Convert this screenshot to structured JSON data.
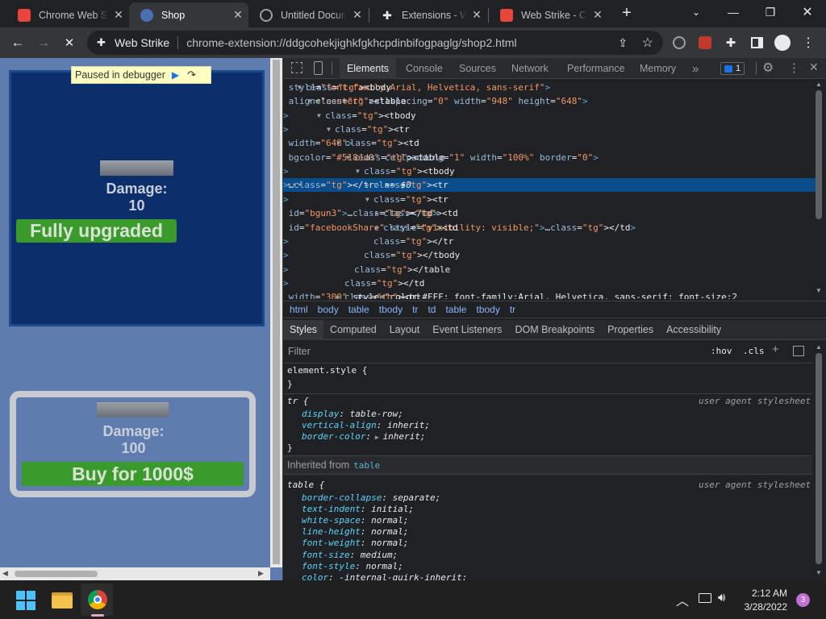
{
  "tabs": [
    {
      "title": "Chrome Web Store - Extensions",
      "fav_color": "#e8453c",
      "active": false
    },
    {
      "title": "Shop",
      "fav_color": "#4a6fb5",
      "active": true
    },
    {
      "title": "Untitled Document",
      "fav_color": "#5f6368",
      "active": false
    },
    {
      "title": "Extensions - Web Strike",
      "fav_color": "#9aa0a6",
      "active": false
    },
    {
      "title": "Web Strike - Chrome",
      "fav_color": "#e8453c",
      "active": false
    }
  ],
  "new_tab_glyph": "+",
  "omnibox": {
    "site_name": "Web Strike",
    "url": "chrome-extension://ddgcohekjighkfgkhcpdinbifogpaglg/shop2.html"
  },
  "debugger_banner": "Paused in debugger",
  "shop": {
    "item1": {
      "damage_label": "Damage:",
      "damage_value": "10",
      "button_label": "Fully upgraded"
    },
    "item2": {
      "damage_label": "Damage:",
      "damage_value": "100",
      "button_label": "Buy for 1000$"
    }
  },
  "devtools": {
    "tabs": [
      "Elements",
      "Console",
      "Sources",
      "Network",
      "Performance",
      "Memory"
    ],
    "more_tabs": "»",
    "issues_count": "1",
    "dom_lines": [
      {
        "indent": 0,
        "arrow": "▼",
        "html": "<body style=\"font-family:Arial, Helvetica, sans-serif\">"
      },
      {
        "indent": 1,
        "arrow": "▼",
        "html": "<table align=\"center\" cellspacing=\"0\" width=\"948\" height=\"648\">"
      },
      {
        "indent": 2,
        "arrow": "▼",
        "html": "<tbody>"
      },
      {
        "indent": 3,
        "arrow": "▼",
        "html": "<tr>"
      },
      {
        "indent": 4,
        "arrow": "▼",
        "html": "<td width=\"648\">"
      },
      {
        "indent": 5,
        "arrow": "▼",
        "html": "<table bgcolor=\"#518ed0\" cellpadding=\"1\" width=\"100%\" border=\"0\">"
      },
      {
        "indent": 6,
        "arrow": "▼",
        "html": "<tbody>"
      },
      {
        "indent": 7,
        "arrow": "▶",
        "html": "<tr>…</tr> == $0",
        "selected": true
      },
      {
        "indent": 7,
        "arrow": "▼",
        "html": "<tr>"
      },
      {
        "indent": 8,
        "arrow": "▶",
        "html": "<td id=\"bgun3\">…</td>"
      },
      {
        "indent": 8,
        "arrow": "▶",
        "html": "<td id=\"facebookShare\" style=\"visibility: visible;\">…</td>"
      },
      {
        "indent": 7,
        "arrow": "",
        "html": "</tr>"
      },
      {
        "indent": 6,
        "arrow": "",
        "html": "</tbody>"
      },
      {
        "indent": 5,
        "arrow": "",
        "html": "</table>"
      },
      {
        "indent": 4,
        "arrow": "",
        "html": "</td>"
      },
      {
        "indent": 4,
        "arrow": "▶",
        "html": "<td width=\"300\" style=\"color:#FFF; font-family:Arial, Helvetica, sans-serif; font-size:2"
      }
    ],
    "breadcrumbs": [
      "html",
      "body",
      "table",
      "tbody",
      "tr",
      "td",
      "table",
      "tbody",
      "tr"
    ],
    "panel_tabs": [
      "Styles",
      "Computed",
      "Layout",
      "Event Listeners",
      "DOM Breakpoints",
      "Properties",
      "Accessibility"
    ],
    "filter_placeholder": "Filter",
    "hov": ":hov",
    "cls": ".cls",
    "element_style": "element.style {",
    "close_brace": "}",
    "ua_label": "user agent stylesheet",
    "tr_rule": {
      "selector": "tr {",
      "props": [
        [
          "display",
          "table-row;"
        ],
        [
          "vertical-align",
          "inherit;"
        ],
        [
          "border-color",
          "inherit;"
        ]
      ]
    },
    "inherited_label": "Inherited from",
    "inherited_from": "table",
    "table_rule": {
      "selector": "table {",
      "props": [
        [
          "border-collapse",
          "separate;"
        ],
        [
          "text-indent",
          "initial;"
        ],
        [
          "white-space",
          "normal;"
        ],
        [
          "line-height",
          "normal;"
        ],
        [
          "font-weight",
          "normal;"
        ],
        [
          "font-size",
          "medium;"
        ],
        [
          "font-style",
          "normal;"
        ],
        [
          "color",
          "-internal-quirk-inherit;"
        ]
      ]
    }
  },
  "taskbar": {
    "time": "2:12 AM",
    "date": "3/28/2022",
    "notifications": "3"
  },
  "colors": {
    "accent_blue": "#8ab4f8",
    "shop_dark": "#0c2f6b",
    "shop_bg": "#5e7cae",
    "button_green": "#3a9a2c"
  }
}
